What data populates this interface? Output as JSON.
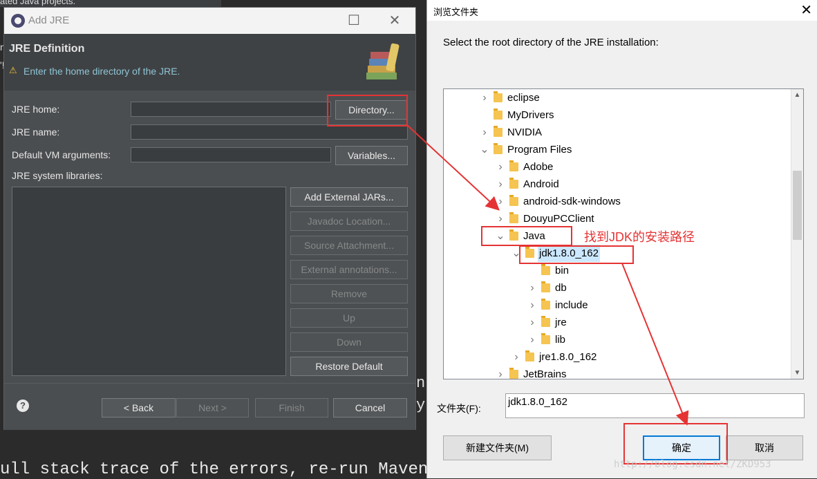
{
  "background": {
    "top_text": "ated Java projects.",
    "console_bottom": "ull stack trace of the errors, re-run Maven with the -e switch.",
    "left_fragments": [
      "n",
      "'!"
    ],
    "right_fragments": [
      "n",
      "y"
    ]
  },
  "add_jre": {
    "window_title": "Add JRE",
    "heading": "JRE Definition",
    "message": "Enter the home directory of the JRE.",
    "jre_home_label": "JRE home:",
    "jre_name_label": "JRE name:",
    "vm_args_label": "Default VM arguments:",
    "system_libraries_label": "JRE system libraries:",
    "directory_button": "Directory...",
    "variables_button": "Variables...",
    "buttons": {
      "add_external_jars": "Add External JARs...",
      "javadoc_location": "Javadoc Location...",
      "source_attachment": "Source Attachment...",
      "external_annotations": "External annotations...",
      "remove": "Remove",
      "up": "Up",
      "down": "Down",
      "restore_default": "Restore Default"
    },
    "footer": {
      "help": "?",
      "back": "< Back",
      "next": "Next >",
      "finish": "Finish",
      "cancel": "Cancel"
    }
  },
  "browse": {
    "window_title": "浏览文件夹",
    "prompt": "Select the root directory of the JRE installation:",
    "tree": [
      {
        "name": "eclipse",
        "level": 0,
        "state": "collapsed"
      },
      {
        "name": "MyDrivers",
        "level": 0,
        "state": "leaf"
      },
      {
        "name": "NVIDIA",
        "level": 0,
        "state": "collapsed"
      },
      {
        "name": "Program Files",
        "level": 0,
        "state": "expanded"
      },
      {
        "name": "Adobe",
        "level": 1,
        "state": "collapsed"
      },
      {
        "name": "Android",
        "level": 1,
        "state": "collapsed"
      },
      {
        "name": "android-sdk-windows",
        "level": 1,
        "state": "collapsed"
      },
      {
        "name": "DouyuPCClient",
        "level": 1,
        "state": "collapsed"
      },
      {
        "name": "Java",
        "level": 1,
        "state": "expanded"
      },
      {
        "name": "jdk1.8.0_162",
        "level": 2,
        "state": "expanded",
        "selected": true
      },
      {
        "name": "bin",
        "level": 3,
        "state": "leaf"
      },
      {
        "name": "db",
        "level": 3,
        "state": "collapsed"
      },
      {
        "name": "include",
        "level": 3,
        "state": "collapsed"
      },
      {
        "name": "jre",
        "level": 3,
        "state": "collapsed"
      },
      {
        "name": "lib",
        "level": 3,
        "state": "collapsed"
      },
      {
        "name": "jre1.8.0_162",
        "level": 2,
        "state": "collapsed"
      },
      {
        "name": "JetBrains",
        "level": 1,
        "state": "collapsed"
      }
    ],
    "folder_label": "文件夹(F):",
    "folder_value": "jdk1.8.0_162",
    "new_folder_button": "新建文件夹(M)",
    "ok_button": "确定",
    "cancel_button": "取消"
  },
  "annotation": {
    "note": "找到JDK的安装路径",
    "color": "#e53333"
  },
  "watermark": "http://blog.csdn.net/ZKD953"
}
